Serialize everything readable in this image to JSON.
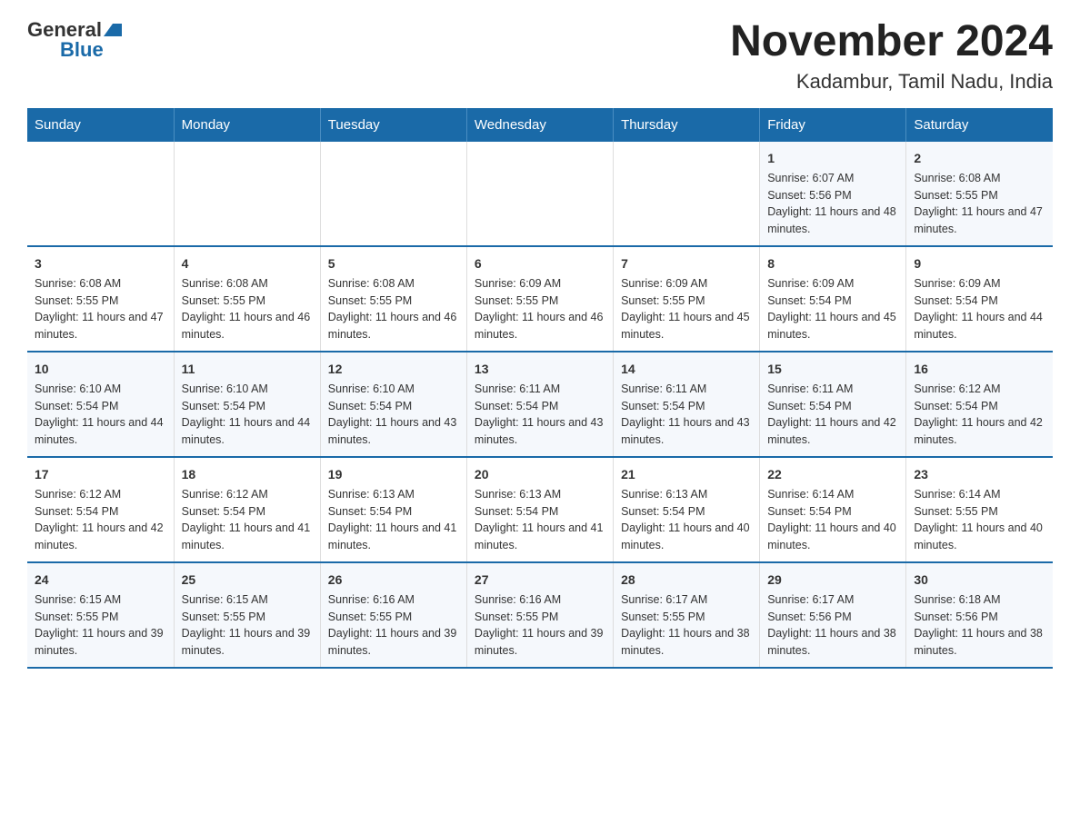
{
  "header": {
    "logo_general": "General",
    "logo_blue": "Blue",
    "title": "November 2024",
    "subtitle": "Kadambur, Tamil Nadu, India"
  },
  "days_of_week": [
    "Sunday",
    "Monday",
    "Tuesday",
    "Wednesday",
    "Thursday",
    "Friday",
    "Saturday"
  ],
  "weeks": [
    [
      {
        "day": "",
        "sunrise": "",
        "sunset": "",
        "daylight": ""
      },
      {
        "day": "",
        "sunrise": "",
        "sunset": "",
        "daylight": ""
      },
      {
        "day": "",
        "sunrise": "",
        "sunset": "",
        "daylight": ""
      },
      {
        "day": "",
        "sunrise": "",
        "sunset": "",
        "daylight": ""
      },
      {
        "day": "",
        "sunrise": "",
        "sunset": "",
        "daylight": ""
      },
      {
        "day": "1",
        "sunrise": "Sunrise: 6:07 AM",
        "sunset": "Sunset: 5:56 PM",
        "daylight": "Daylight: 11 hours and 48 minutes."
      },
      {
        "day": "2",
        "sunrise": "Sunrise: 6:08 AM",
        "sunset": "Sunset: 5:55 PM",
        "daylight": "Daylight: 11 hours and 47 minutes."
      }
    ],
    [
      {
        "day": "3",
        "sunrise": "Sunrise: 6:08 AM",
        "sunset": "Sunset: 5:55 PM",
        "daylight": "Daylight: 11 hours and 47 minutes."
      },
      {
        "day": "4",
        "sunrise": "Sunrise: 6:08 AM",
        "sunset": "Sunset: 5:55 PM",
        "daylight": "Daylight: 11 hours and 46 minutes."
      },
      {
        "day": "5",
        "sunrise": "Sunrise: 6:08 AM",
        "sunset": "Sunset: 5:55 PM",
        "daylight": "Daylight: 11 hours and 46 minutes."
      },
      {
        "day": "6",
        "sunrise": "Sunrise: 6:09 AM",
        "sunset": "Sunset: 5:55 PM",
        "daylight": "Daylight: 11 hours and 46 minutes."
      },
      {
        "day": "7",
        "sunrise": "Sunrise: 6:09 AM",
        "sunset": "Sunset: 5:55 PM",
        "daylight": "Daylight: 11 hours and 45 minutes."
      },
      {
        "day": "8",
        "sunrise": "Sunrise: 6:09 AM",
        "sunset": "Sunset: 5:54 PM",
        "daylight": "Daylight: 11 hours and 45 minutes."
      },
      {
        "day": "9",
        "sunrise": "Sunrise: 6:09 AM",
        "sunset": "Sunset: 5:54 PM",
        "daylight": "Daylight: 11 hours and 44 minutes."
      }
    ],
    [
      {
        "day": "10",
        "sunrise": "Sunrise: 6:10 AM",
        "sunset": "Sunset: 5:54 PM",
        "daylight": "Daylight: 11 hours and 44 minutes."
      },
      {
        "day": "11",
        "sunrise": "Sunrise: 6:10 AM",
        "sunset": "Sunset: 5:54 PM",
        "daylight": "Daylight: 11 hours and 44 minutes."
      },
      {
        "day": "12",
        "sunrise": "Sunrise: 6:10 AM",
        "sunset": "Sunset: 5:54 PM",
        "daylight": "Daylight: 11 hours and 43 minutes."
      },
      {
        "day": "13",
        "sunrise": "Sunrise: 6:11 AM",
        "sunset": "Sunset: 5:54 PM",
        "daylight": "Daylight: 11 hours and 43 minutes."
      },
      {
        "day": "14",
        "sunrise": "Sunrise: 6:11 AM",
        "sunset": "Sunset: 5:54 PM",
        "daylight": "Daylight: 11 hours and 43 minutes."
      },
      {
        "day": "15",
        "sunrise": "Sunrise: 6:11 AM",
        "sunset": "Sunset: 5:54 PM",
        "daylight": "Daylight: 11 hours and 42 minutes."
      },
      {
        "day": "16",
        "sunrise": "Sunrise: 6:12 AM",
        "sunset": "Sunset: 5:54 PM",
        "daylight": "Daylight: 11 hours and 42 minutes."
      }
    ],
    [
      {
        "day": "17",
        "sunrise": "Sunrise: 6:12 AM",
        "sunset": "Sunset: 5:54 PM",
        "daylight": "Daylight: 11 hours and 42 minutes."
      },
      {
        "day": "18",
        "sunrise": "Sunrise: 6:12 AM",
        "sunset": "Sunset: 5:54 PM",
        "daylight": "Daylight: 11 hours and 41 minutes."
      },
      {
        "day": "19",
        "sunrise": "Sunrise: 6:13 AM",
        "sunset": "Sunset: 5:54 PM",
        "daylight": "Daylight: 11 hours and 41 minutes."
      },
      {
        "day": "20",
        "sunrise": "Sunrise: 6:13 AM",
        "sunset": "Sunset: 5:54 PM",
        "daylight": "Daylight: 11 hours and 41 minutes."
      },
      {
        "day": "21",
        "sunrise": "Sunrise: 6:13 AM",
        "sunset": "Sunset: 5:54 PM",
        "daylight": "Daylight: 11 hours and 40 minutes."
      },
      {
        "day": "22",
        "sunrise": "Sunrise: 6:14 AM",
        "sunset": "Sunset: 5:54 PM",
        "daylight": "Daylight: 11 hours and 40 minutes."
      },
      {
        "day": "23",
        "sunrise": "Sunrise: 6:14 AM",
        "sunset": "Sunset: 5:55 PM",
        "daylight": "Daylight: 11 hours and 40 minutes."
      }
    ],
    [
      {
        "day": "24",
        "sunrise": "Sunrise: 6:15 AM",
        "sunset": "Sunset: 5:55 PM",
        "daylight": "Daylight: 11 hours and 39 minutes."
      },
      {
        "day": "25",
        "sunrise": "Sunrise: 6:15 AM",
        "sunset": "Sunset: 5:55 PM",
        "daylight": "Daylight: 11 hours and 39 minutes."
      },
      {
        "day": "26",
        "sunrise": "Sunrise: 6:16 AM",
        "sunset": "Sunset: 5:55 PM",
        "daylight": "Daylight: 11 hours and 39 minutes."
      },
      {
        "day": "27",
        "sunrise": "Sunrise: 6:16 AM",
        "sunset": "Sunset: 5:55 PM",
        "daylight": "Daylight: 11 hours and 39 minutes."
      },
      {
        "day": "28",
        "sunrise": "Sunrise: 6:17 AM",
        "sunset": "Sunset: 5:55 PM",
        "daylight": "Daylight: 11 hours and 38 minutes."
      },
      {
        "day": "29",
        "sunrise": "Sunrise: 6:17 AM",
        "sunset": "Sunset: 5:56 PM",
        "daylight": "Daylight: 11 hours and 38 minutes."
      },
      {
        "day": "30",
        "sunrise": "Sunrise: 6:18 AM",
        "sunset": "Sunset: 5:56 PM",
        "daylight": "Daylight: 11 hours and 38 minutes."
      }
    ]
  ]
}
